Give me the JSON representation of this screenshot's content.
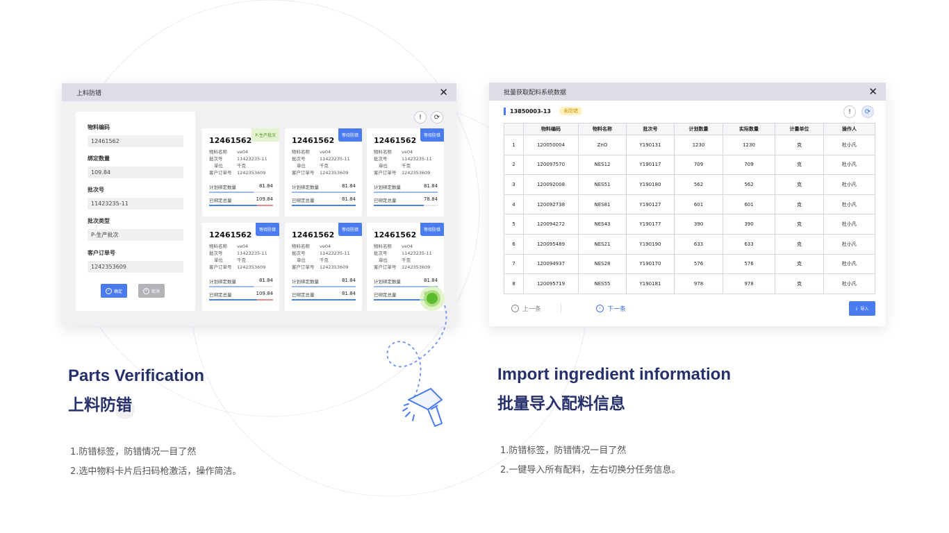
{
  "colors": {
    "accent": "#4a7cf0",
    "title": "#26306a",
    "tag_green_bg": "#e4f3d0",
    "badge_bg": "#fff0bf"
  },
  "left_dialog": {
    "title": "上料防错",
    "close_icon": "close-icon",
    "form": {
      "fields": [
        {
          "label": "物料编码",
          "value": "12461562"
        },
        {
          "label": "绑定数量",
          "value": "109.84"
        },
        {
          "label": "批次号",
          "value": "11423235-11"
        },
        {
          "label": "批次类型",
          "value": "P-生产批次"
        },
        {
          "label": "客户订单号",
          "value": "1242353609"
        }
      ],
      "confirm_label": "确定",
      "cancel_label": "取消"
    },
    "cards": [
      {
        "code": "12461562",
        "tag": "P-生产批次",
        "tag_type": "green",
        "name_label": "物料名称",
        "name": "ve04",
        "batch_label": "批次号",
        "batch": "11423235-11",
        "unit_label": "单位",
        "unit": "千克",
        "order_label": "客户订单号",
        "order": "1242353609",
        "plan_label": "计划绑定数量",
        "plan": "81.84",
        "bound_label": "已绑定总量",
        "bound": "109.84",
        "plan_pct": 0.7,
        "bound_pct": 1.0,
        "bound_over": true
      },
      {
        "code": "12461562",
        "tag": "等待防错",
        "tag_type": "blue",
        "name_label": "物料名称",
        "name": "ve04",
        "batch_label": "批次号",
        "batch": "11423235-11",
        "unit_label": "单位",
        "unit": "千克",
        "order_label": "客户订单号",
        "order": "1242353609",
        "plan_label": "计划绑定数量",
        "plan": "81.84",
        "bound_label": "已绑定总量",
        "bound": "81.84",
        "plan_pct": 1.0,
        "bound_pct": 1.0,
        "bound_over": false
      },
      {
        "code": "12461562",
        "tag": "等待防错",
        "tag_type": "blue",
        "name_label": "物料名称",
        "name": "ve04",
        "batch_label": "批次号",
        "batch": "11423235-11",
        "unit_label": "单位",
        "unit": "千克",
        "order_label": "客户订单号",
        "order": "1242353609",
        "plan_label": "计划绑定数量",
        "plan": "81.84",
        "bound_label": "已绑定总量",
        "bound": "78.84",
        "plan_pct": 1.0,
        "bound_pct": 0.78,
        "bound_over": false
      },
      {
        "code": "12461562",
        "tag": "等待防错",
        "tag_type": "blue",
        "name_label": "物料名称",
        "name": "ve04",
        "batch_label": "批次号",
        "batch": "11423235-11",
        "unit_label": "单位",
        "unit": "千克",
        "order_label": "客户订单号",
        "order": "1242353609",
        "plan_label": "计划绑定数量",
        "plan": "81.84",
        "bound_label": "已绑定总量",
        "bound": "109.84",
        "plan_pct": 0.7,
        "bound_pct": 1.0,
        "bound_over": true
      },
      {
        "code": "12461562",
        "tag": "等待防错",
        "tag_type": "blue",
        "name_label": "物料名称",
        "name": "ve04",
        "batch_label": "批次号",
        "batch": "11423235-11",
        "unit_label": "单位",
        "unit": "千克",
        "order_label": "客户订单号",
        "order": "1242353609",
        "plan_label": "计划绑定数量",
        "plan": "81.84",
        "bound_label": "已绑定总量",
        "bound": "81.84",
        "plan_pct": 1.0,
        "bound_pct": 1.0,
        "bound_over": false
      },
      {
        "code": "12461562",
        "tag": "等待防错",
        "tag_type": "blue",
        "name_label": "物料名称",
        "name": "ve04",
        "batch_label": "批次号",
        "batch": "11423235-11",
        "unit_label": "单位",
        "unit": "千克",
        "order_label": "客户订单号",
        "order": "1242353609",
        "plan_label": "计划绑定数量",
        "plan": "81.84",
        "bound_label": "已绑定总量",
        "bound": "81.84",
        "plan_pct": 1.0,
        "bound_pct": 1.0,
        "bound_over": false
      }
    ]
  },
  "right_dialog": {
    "title": "批量获取配料系统数据",
    "order_no": "13850003-13",
    "status_badge": "未防错",
    "columns": [
      "",
      "物料编码",
      "物料名称",
      "批次号",
      "计划数量",
      "实际数量",
      "计量单位",
      "操作人"
    ],
    "rows": [
      [
        "1",
        "120050004",
        "ZnO",
        "Y190131",
        "1230",
        "1230",
        "克",
        "杜小凡"
      ],
      [
        "2",
        "120097570",
        "NES12",
        "Y190117",
        "709",
        "709",
        "克",
        "杜小凡"
      ],
      [
        "3",
        "120092008",
        "NES51",
        "Y190180",
        "562",
        "562",
        "克",
        "杜小凡"
      ],
      [
        "4",
        "120092738",
        "NES81",
        "Y190127",
        "601",
        "601",
        "克",
        "杜小凡"
      ],
      [
        "5",
        "120094272",
        "NES43",
        "Y190177",
        "390",
        "390",
        "克",
        "杜小凡"
      ],
      [
        "6",
        "120095489",
        "NES21",
        "Y190190",
        "633",
        "633",
        "克",
        "杜小凡"
      ],
      [
        "7",
        "120094937",
        "NES28",
        "Y190170",
        "576",
        "576",
        "克",
        "杜小凡"
      ],
      [
        "8",
        "120095719",
        "NES55",
        "Y190181",
        "978",
        "978",
        "克",
        "杜小凡"
      ]
    ],
    "prev_label": "上一条",
    "next_label": "下一条",
    "import_label": "导入"
  },
  "captions": {
    "left_en": "Parts Verification",
    "left_zh": "上料防错",
    "left_desc": [
      "1.防错标签，防错情况一目了然",
      "2.选中物料卡片后扫码枪激活，操作简洁。"
    ],
    "right_en": "Import ingredient information",
    "right_zh": "批量导入配料信息",
    "right_desc": [
      "1.防错标签，防错情况一目了然",
      "2.一键导入所有配料，左右切换分任务信息。"
    ]
  }
}
